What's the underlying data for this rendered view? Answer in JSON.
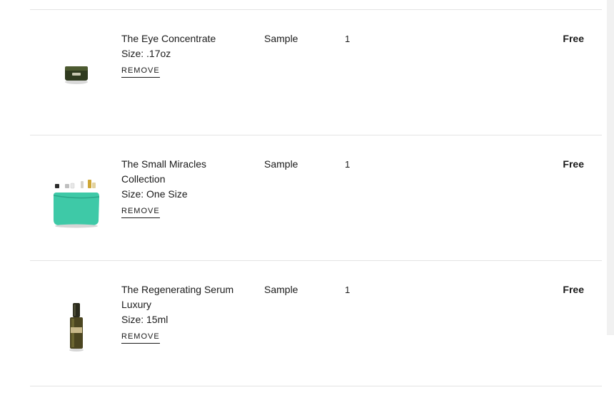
{
  "cart": {
    "items": [
      {
        "name_lines": [
          "The Eye Concentrate"
        ],
        "size": "Size: .17oz",
        "type": "Sample",
        "quantity": "1",
        "price": "Free",
        "remove_label": "REMOVE",
        "image_icon": "eye-concentrate-jar"
      },
      {
        "name_lines": [
          "The Small Miracles",
          "Collection"
        ],
        "size": "Size: One Size",
        "type": "Sample",
        "quantity": "1",
        "price": "Free",
        "remove_label": "REMOVE",
        "image_icon": "collection-pouch"
      },
      {
        "name_lines": [
          "The Regenerating Serum",
          "Luxury"
        ],
        "size": "Size: 15ml",
        "type": "Sample",
        "quantity": "1",
        "price": "Free",
        "remove_label": "REMOVE",
        "image_icon": "serum-bottle"
      }
    ]
  },
  "colors": {
    "divider": "#e3e3e3",
    "text": "#1a1a1a",
    "pouch": "#3ec9a7",
    "jar_lid": "#2f3a1f"
  }
}
